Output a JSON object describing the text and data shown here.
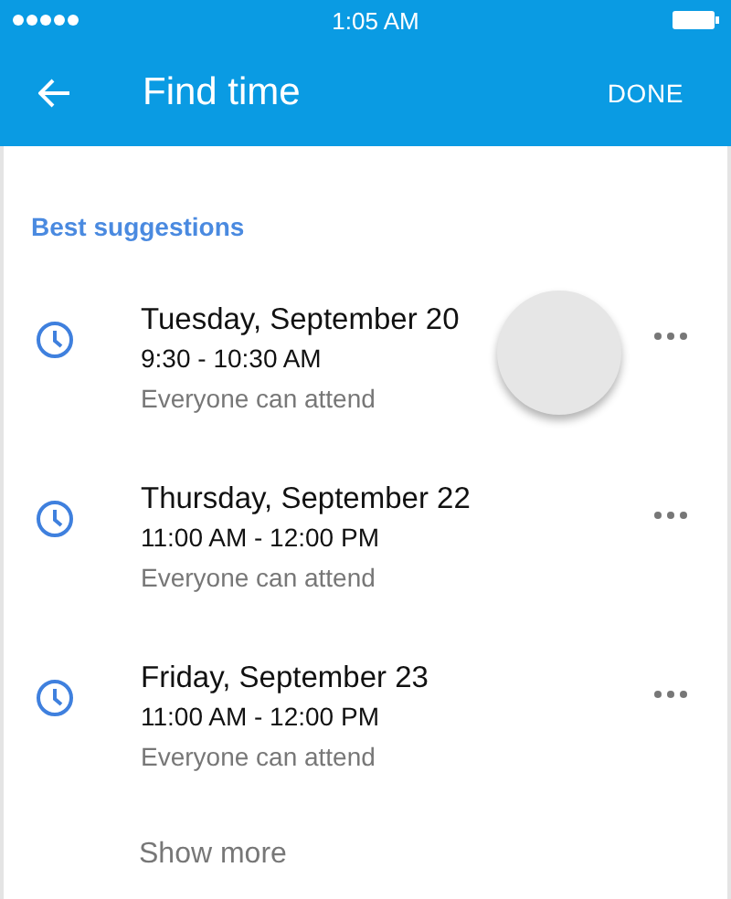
{
  "status_bar": {
    "time": "1:05 AM"
  },
  "app_bar": {
    "title": "Find time",
    "action": "DONE"
  },
  "section_title": "Best suggestions",
  "suggestions": [
    {
      "date": "Tuesday, September 20",
      "time": "9:30 - 10:30 AM",
      "note": "Everyone can attend",
      "touched": true
    },
    {
      "date": "Thursday, September 22",
      "time": "11:00 AM - 12:00 PM",
      "note": "Everyone can attend",
      "touched": false
    },
    {
      "date": "Friday, September 23",
      "time": "11:00 AM - 12:00 PM",
      "note": "Everyone can attend",
      "touched": false
    }
  ],
  "show_more": "Show more"
}
